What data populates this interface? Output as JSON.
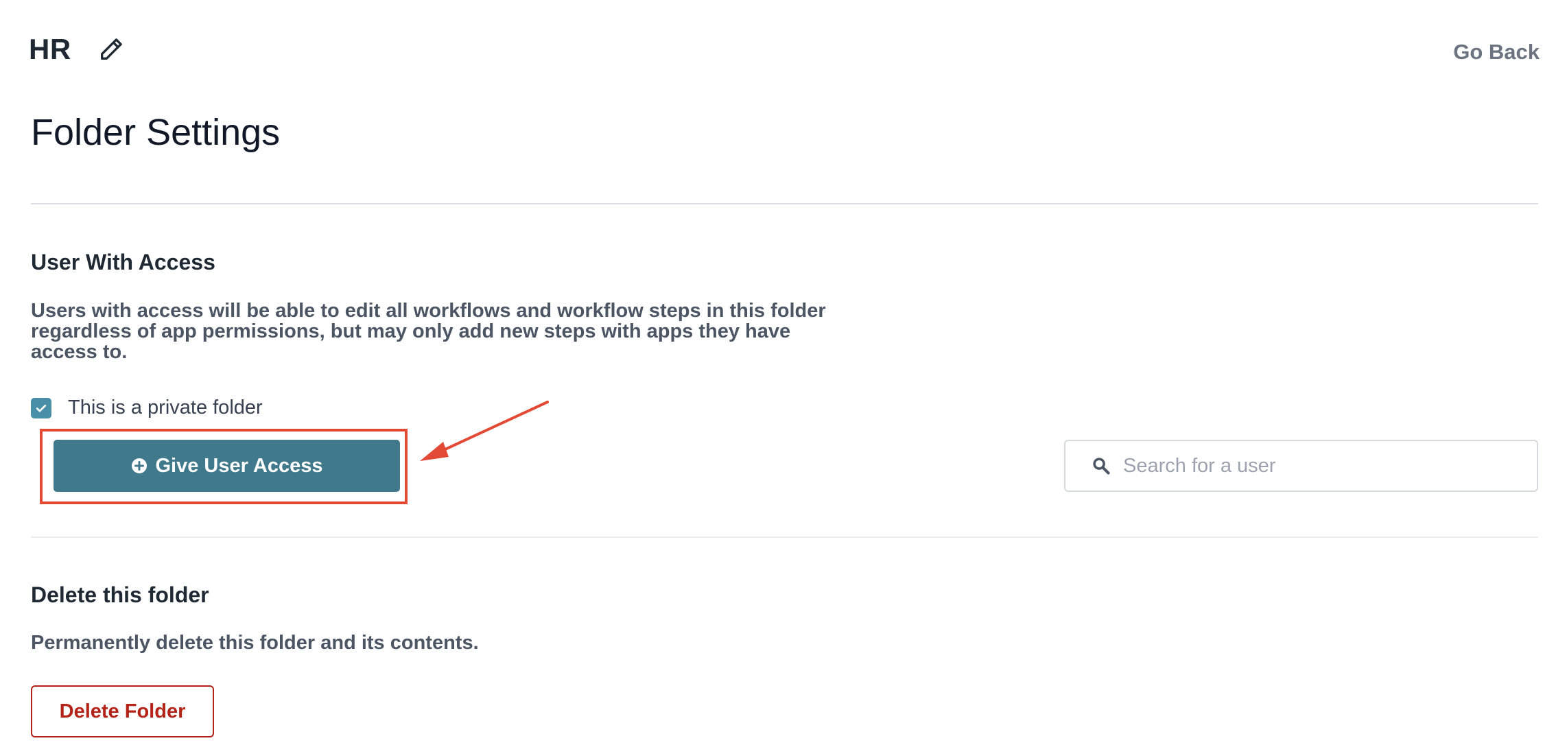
{
  "header": {
    "folder_name": "HR",
    "edit_icon": "pencil-icon",
    "go_back_label": "Go Back"
  },
  "page_title": "Folder Settings",
  "access_section": {
    "title": "User With Access",
    "description": "Users with access will be able to edit all workflows and workflow steps in this folder regardless of app permissions, but may only add new steps with apps they have access to.",
    "private_checkbox": {
      "label": "This is a private folder",
      "checked": true
    },
    "give_access_button_label": "Give User Access",
    "give_access_icon": "plus-circle-icon",
    "search": {
      "placeholder": "Search for a user",
      "value": "",
      "icon": "search-icon"
    }
  },
  "delete_section": {
    "title": "Delete this folder",
    "description": "Permanently delete this folder and its contents.",
    "delete_button_label": "Delete Folder"
  },
  "colors": {
    "primary_button": "#41798c",
    "checkbox": "#4a8fa8",
    "danger": "#b42318",
    "annotation": "#e34a35"
  }
}
